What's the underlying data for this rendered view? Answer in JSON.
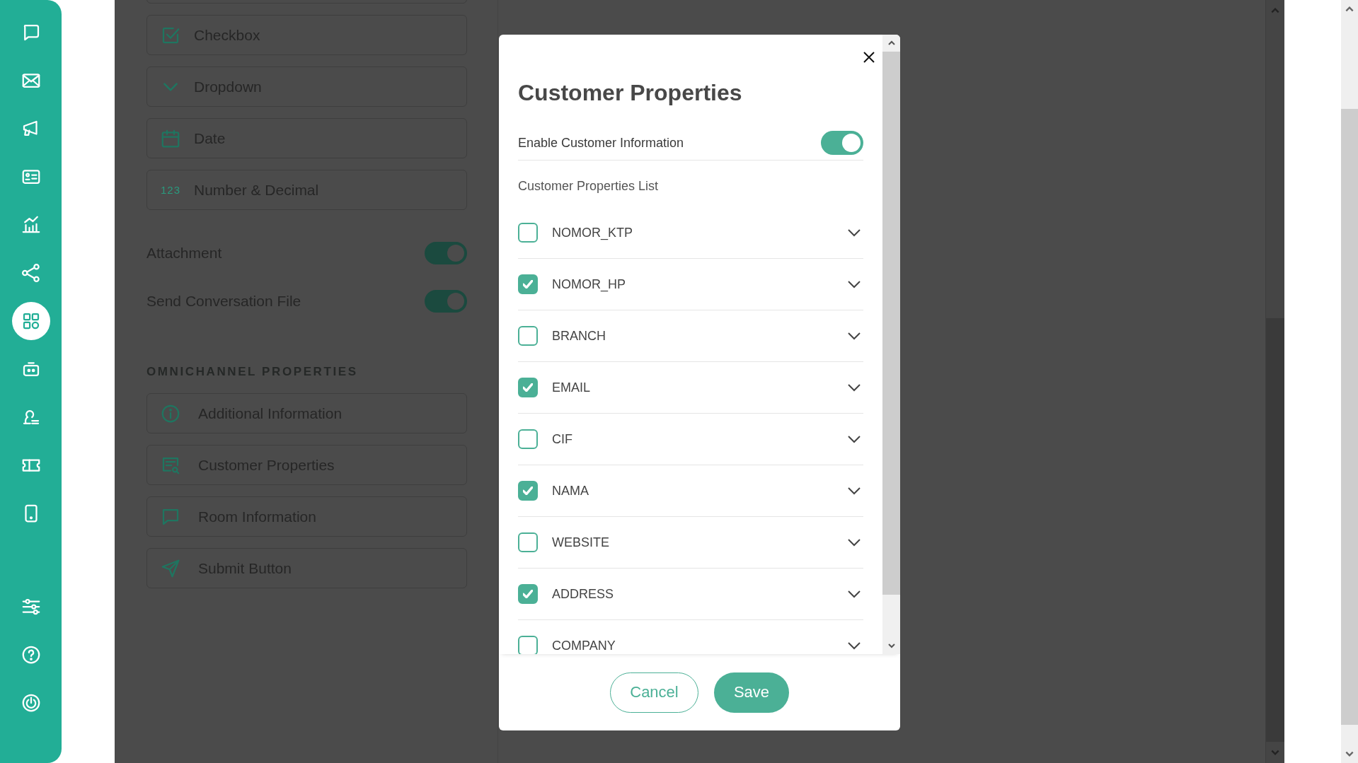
{
  "sidebar": {
    "items": [
      {
        "kind": "chat",
        "selected": false
      },
      {
        "kind": "mail",
        "selected": false
      },
      {
        "kind": "broadcast",
        "selected": false
      },
      {
        "kind": "contacts",
        "selected": false
      },
      {
        "kind": "analytics",
        "selected": false
      },
      {
        "kind": "integration",
        "selected": false
      },
      {
        "kind": "apps",
        "selected": true
      },
      {
        "kind": "bot",
        "selected": false
      },
      {
        "kind": "agents",
        "selected": false
      },
      {
        "kind": "ticket",
        "selected": false
      },
      {
        "kind": "device",
        "selected": false
      },
      {
        "kind": "settings",
        "selected": false
      },
      {
        "kind": "help",
        "selected": false
      },
      {
        "kind": "logout",
        "selected": false
      }
    ]
  },
  "field_options": [
    {
      "kind": "checkbox",
      "label": "Checkbox"
    },
    {
      "kind": "dropdown",
      "label": "Dropdown"
    },
    {
      "kind": "date",
      "label": "Date"
    },
    {
      "kind": "number",
      "badge": "123",
      "label": "Number & Decimal"
    }
  ],
  "switches": [
    {
      "label": "Attachment",
      "on": true
    },
    {
      "label": "Send Conversation File",
      "on": true
    }
  ],
  "omnichannel": {
    "heading": "OMNICHANNEL PROPERTIES",
    "items": [
      {
        "kind": "info",
        "label": "Additional Information"
      },
      {
        "kind": "properties",
        "label": "Customer Properties"
      },
      {
        "kind": "room",
        "label": "Room Information"
      },
      {
        "kind": "submit",
        "label": "Submit Button"
      }
    ]
  },
  "dialog": {
    "title": "Customer Properties",
    "enable": {
      "label": "Enable Customer Information",
      "on": true
    },
    "list_label": "Customer Properties List",
    "properties": [
      {
        "name": "NOMOR_KTP",
        "checked": false
      },
      {
        "name": "NOMOR_HP",
        "checked": true
      },
      {
        "name": "BRANCH",
        "checked": false
      },
      {
        "name": "EMAIL",
        "checked": true
      },
      {
        "name": "CIF",
        "checked": false
      },
      {
        "name": "NAMA",
        "checked": true
      },
      {
        "name": "WEBSITE",
        "checked": false
      },
      {
        "name": "ADDRESS",
        "checked": true
      },
      {
        "name": "COMPANY",
        "checked": false
      }
    ],
    "buttons": [
      {
        "kind": "secondary",
        "label": "Cancel"
      },
      {
        "kind": "primary",
        "label": "Save"
      }
    ]
  }
}
